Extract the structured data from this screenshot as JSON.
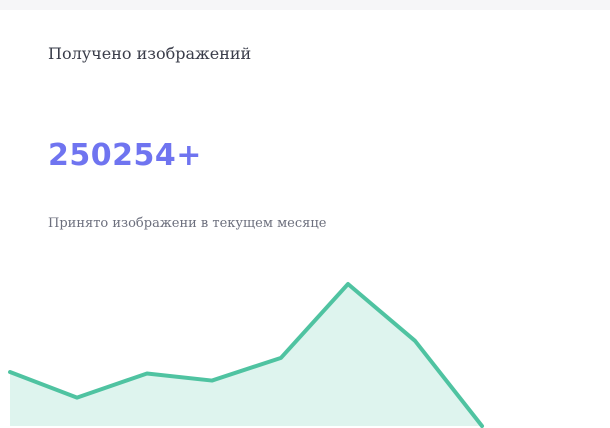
{
  "widget": {
    "title": "Получено изображений",
    "value": "250254+",
    "caption": "Принято изображени в текущем месяце"
  },
  "colors": {
    "accent_value": "#6f74f0",
    "line": "#4fc3a1",
    "area": "#def4ee"
  },
  "chart_data": {
    "type": "area",
    "x": [
      0,
      1,
      2,
      3,
      4,
      5,
      6,
      7
    ],
    "values": [
      38,
      20,
      37,
      32,
      48,
      100,
      60,
      0
    ],
    "ylim": [
      0,
      100
    ],
    "title": "",
    "xlabel": "",
    "ylabel": "",
    "grid": false,
    "axes_visible": false
  }
}
